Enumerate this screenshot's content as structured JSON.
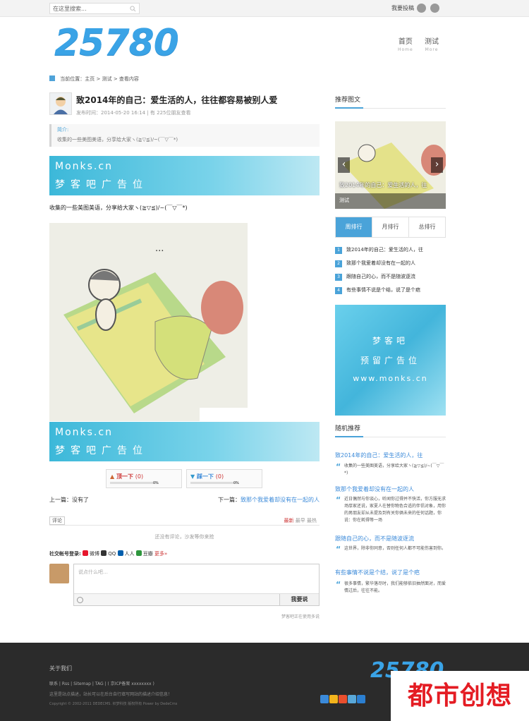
{
  "topbar": {
    "search_placeholder": "在这里搜索...",
    "submit_link": "我要投稿"
  },
  "logo": "25780",
  "nav": [
    {
      "label": "首页",
      "sub": "Home"
    },
    {
      "label": "测试",
      "sub": "More"
    }
  ],
  "breadcrumb": {
    "prefix": "当前位置：",
    "home": "主页",
    "sep": ">",
    "cat": "测试",
    "current": "查看内容"
  },
  "article": {
    "title": "致2014年的自己：爱生活的人，往往都容易被别人爱",
    "meta": "发布时间：2014-05-20 16:14  |  有 225位朋友查看",
    "summary_label": "简介:",
    "summary": "收集的一些美图美语，分享给大家ヽ(≧▽≦)/~(￣▽￣*)",
    "lead": "收集的一些美图美语，分享给大家ヽ(≧▽≦)/~(￣▽￣*)"
  },
  "ad": {
    "line1": "Monks.cn",
    "line2": "梦客吧广告位"
  },
  "vote": {
    "up_label": "顶一下",
    "up_count": "(0)",
    "up_pct": "0%",
    "down_label": "踩一下",
    "down_count": "(0)",
    "down_pct": "0%"
  },
  "pager": {
    "prev": "上一篇：没有了",
    "next_prefix": "下一篇：",
    "next_title": "致那个我爱着却没有在一起的人"
  },
  "comments": {
    "tag": "评论",
    "sort_new": "最新",
    "sort_early": "最早",
    "sort_hot": "最热",
    "empty": "还没有评论，沙发等你来抢",
    "social_label": "社交帐号登录:",
    "social": [
      "微博",
      "QQ",
      "人人",
      "豆瓣"
    ],
    "more": "更多»",
    "placeholder": "说点什么吧…",
    "submit": "我要说",
    "footnote": "梦客吧正在使用多说"
  },
  "sidebar": {
    "recommend_title": "推荐图文",
    "slide_caption": "致2014年的自己：爱生活的人，往",
    "slide_foot": "测试",
    "tabs": [
      "周排行",
      "月排行",
      "总排行"
    ],
    "rank": [
      {
        "n": "1",
        "title": "致2014年的自己：爱生活的人，往"
      },
      {
        "n": "2",
        "title": "致那个我爱着却没有在一起的人"
      },
      {
        "n": "3",
        "title": "跟随自己的心，而不是随波逐流"
      },
      {
        "n": "4",
        "title": "有些事情不说是个结，说了是个疤"
      }
    ],
    "ad_lines": [
      "梦客吧",
      "预留广告位",
      "www.monks.cn"
    ],
    "random_title": "随机推荐",
    "random": [
      {
        "title": "致2014年的自己：爱生活的人，往",
        "desc": "收集的一些美图美语，分享给大家ヽ(≧▽≦)/~(￣▽￣*)"
      },
      {
        "title": "致那个我爱着却没有在一起的人",
        "desc": "近日偶然与你谈心，听闻你过得并不快活，你方服无求场厚家还说，家夏人在替你物色合适的伴侣对象，用你的男朋友却从未提及到有关你俩未来的任何话题，你说：你在耗得等一场"
      },
      {
        "title": "跟随自己的心，而不是随波逐流",
        "desc": "这世界，除非你同意，否则任何人都不可能伤害到你。"
      },
      {
        "title": "有些事情不说是个结，说了是个疤",
        "desc": "很多事情，繁华落尽时，我们能够依旧抽然面对，而爱情过后，往往不能。"
      }
    ]
  },
  "footer": {
    "heading": "关于我们",
    "links": "联系  |  Rss  |  Sitemap  |  TAG  |  ( 京ICP备案 xxxxxxxx )",
    "desc": "这里是站点描述，站长可以在后台自行填写网站的描述介绍信息！",
    "copy": "Copyright © 2002-2011 DEDECMS. 织梦科技 版权所有 Power by DedeCms",
    "logo": "25780"
  },
  "watermark": "都市创想"
}
